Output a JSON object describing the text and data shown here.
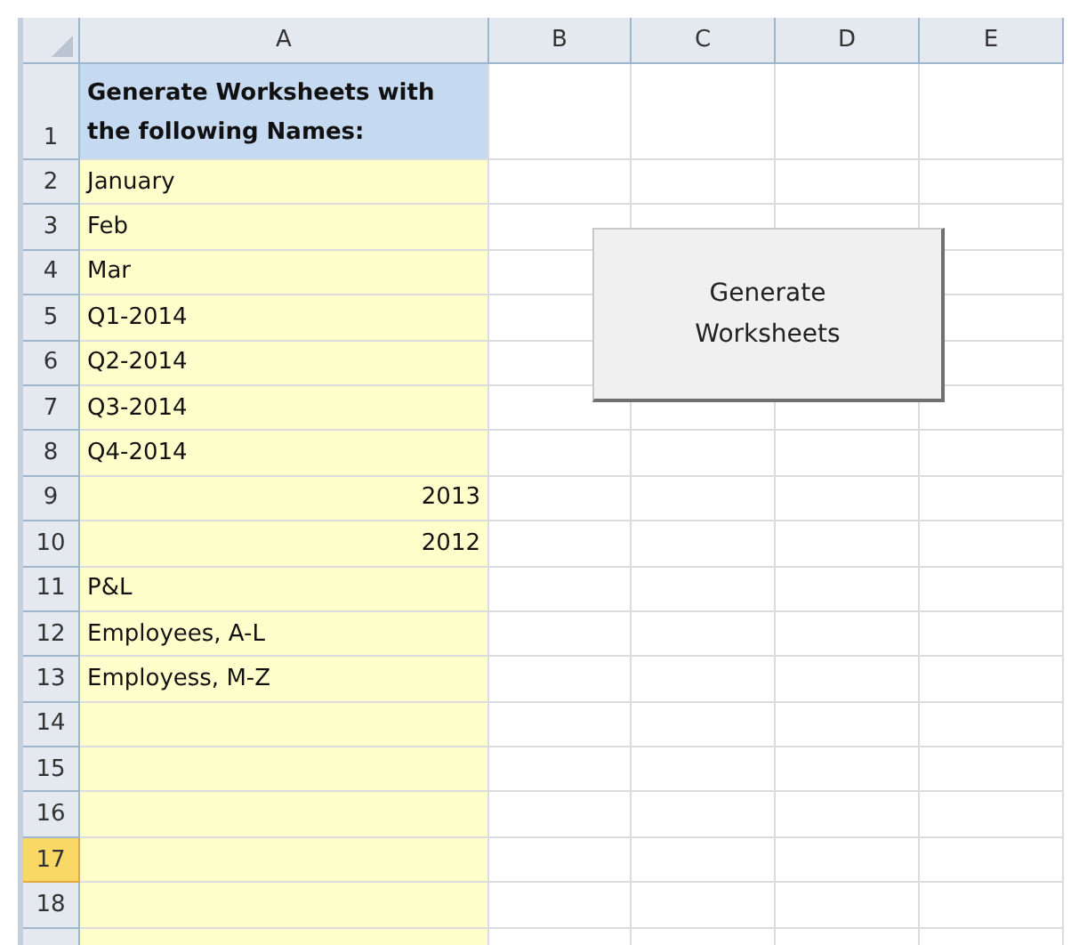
{
  "columns": [
    {
      "label": "A",
      "selected": false
    },
    {
      "label": "B",
      "selected": false
    },
    {
      "label": "C",
      "selected": false
    },
    {
      "label": "D",
      "selected": false
    },
    {
      "label": "E",
      "selected": false
    }
  ],
  "rows": [
    {
      "number": "1",
      "selected": false,
      "kind": "header",
      "a": "Generate Worksheets with the following Names:"
    },
    {
      "number": "2",
      "selected": false,
      "kind": "text",
      "a": "January"
    },
    {
      "number": "3",
      "selected": false,
      "kind": "text",
      "a": "Feb"
    },
    {
      "number": "4",
      "selected": false,
      "kind": "text",
      "a": "Mar"
    },
    {
      "number": "5",
      "selected": false,
      "kind": "text",
      "a": "Q1-2014"
    },
    {
      "number": "6",
      "selected": false,
      "kind": "text",
      "a": "Q2-2014"
    },
    {
      "number": "7",
      "selected": false,
      "kind": "text",
      "a": "Q3-2014"
    },
    {
      "number": "8",
      "selected": false,
      "kind": "text",
      "a": "Q4-2014"
    },
    {
      "number": "9",
      "selected": false,
      "kind": "number",
      "a": "2013"
    },
    {
      "number": "10",
      "selected": false,
      "kind": "number",
      "a": "2012"
    },
    {
      "number": "11",
      "selected": false,
      "kind": "text",
      "a": "P&L"
    },
    {
      "number": "12",
      "selected": false,
      "kind": "text",
      "a": "Employees, A-L"
    },
    {
      "number": "13",
      "selected": false,
      "kind": "text",
      "a": "Employess, M-Z"
    },
    {
      "number": "14",
      "selected": false,
      "kind": "empty"
    },
    {
      "number": "15",
      "selected": false,
      "kind": "empty"
    },
    {
      "number": "16",
      "selected": false,
      "kind": "empty"
    },
    {
      "number": "17",
      "selected": true,
      "kind": "empty"
    },
    {
      "number": "18",
      "selected": false,
      "kind": "empty"
    }
  ],
  "button": {
    "label": "Generate Worksheets"
  }
}
